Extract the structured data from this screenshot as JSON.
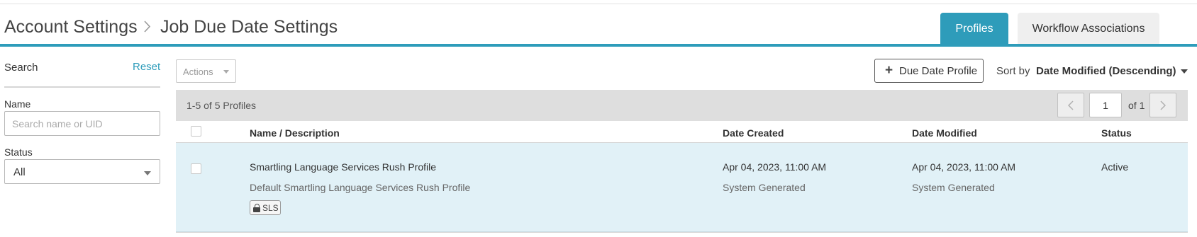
{
  "header": {
    "breadcrumb": [
      "Account Settings",
      "Job Due Date Settings"
    ],
    "tabs": [
      {
        "label": "Profiles",
        "active": true
      },
      {
        "label": "Workflow Associations",
        "active": false
      }
    ],
    "accent_color": "#2e9cba"
  },
  "sidebar": {
    "search_label": "Search",
    "reset_label": "Reset",
    "name_label": "Name",
    "name_placeholder": "Search name or UID",
    "name_value": "",
    "status_label": "Status",
    "status_value": "All"
  },
  "toolbar": {
    "actions_label": "Actions",
    "add_label": "Due Date Profile",
    "sort_label": "Sort by",
    "sort_value": "Date Modified (Descending)"
  },
  "pagination": {
    "count_text": "1-5 of 5 Profiles",
    "current_page": "1",
    "of_text": "of 1"
  },
  "table": {
    "columns": [
      "Name / Description",
      "Date Created",
      "Date Modified",
      "Status"
    ],
    "rows": [
      {
        "name": "Smartling Language Services Rush Profile",
        "description": "Default Smartling Language Services Rush Profile",
        "badge": "SLS",
        "date_created": "Apr 04, 2023, 11:00 AM",
        "created_by": "System Generated",
        "date_modified": "Apr 04, 2023, 11:00 AM",
        "modified_by": "System Generated",
        "status": "Active"
      }
    ]
  }
}
